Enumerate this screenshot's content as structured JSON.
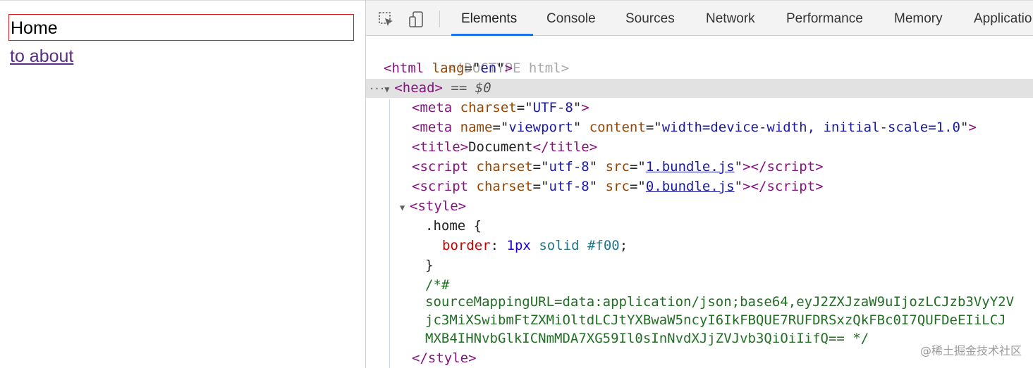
{
  "page": {
    "home_text": "Home",
    "about_link": "to about"
  },
  "devtools": {
    "tabs": [
      "Elements",
      "Console",
      "Sources",
      "Network",
      "Performance",
      "Memory",
      "Applicatio"
    ],
    "active_tab": "Elements",
    "tree": {
      "doctype": "<!DOCTYPE html>",
      "html_open": {
        "tag": "html",
        "attr": "lang",
        "val": "en"
      },
      "head": {
        "tag": "head",
        "suffix": "== ",
        "dollar": "$0"
      },
      "meta1": {
        "tag": "meta",
        "attr": "charset",
        "val": "UTF-8"
      },
      "meta2": {
        "tag": "meta",
        "attr1": "name",
        "val1": "viewport",
        "attr2": "content",
        "val2": "width=device-width, initial-scale=1.0"
      },
      "title": {
        "tag": "title",
        "text": "Document"
      },
      "script1": {
        "tag": "script",
        "attr1": "charset",
        "val1": "utf-8",
        "attr2": "src",
        "val2": "1.bundle.js"
      },
      "script2": {
        "tag": "script",
        "attr1": "charset",
        "val1": "utf-8",
        "attr2": "src",
        "val2": "0.bundle.js"
      },
      "style_open": {
        "tag": "style"
      },
      "css_selector": ".home {",
      "css_prop": "border",
      "css_num": "1px",
      "css_kw": "solid",
      "css_color": "#f00",
      "css_close": "}",
      "comment_open": "/*#",
      "comment_line1": "sourceMappingURL=data:application/json;base64,eyJ2ZXJzaW9uIjozLCJzb3VyY2V",
      "comment_line2": "jc3MiXSwibmFtZXMiOltdLCJtYXBwaW5ncyI6IkFBQUE7RUFDRSxzQkFBc0I7QUFDeEIiLCJ",
      "comment_line3": "MXB4IHNvbGlkICNmMDA7XG59Il0sInNvdXJjZVJvb3QiOiIifQ== */",
      "style_close": "style"
    }
  },
  "watermark": "@稀土掘金技术社区"
}
